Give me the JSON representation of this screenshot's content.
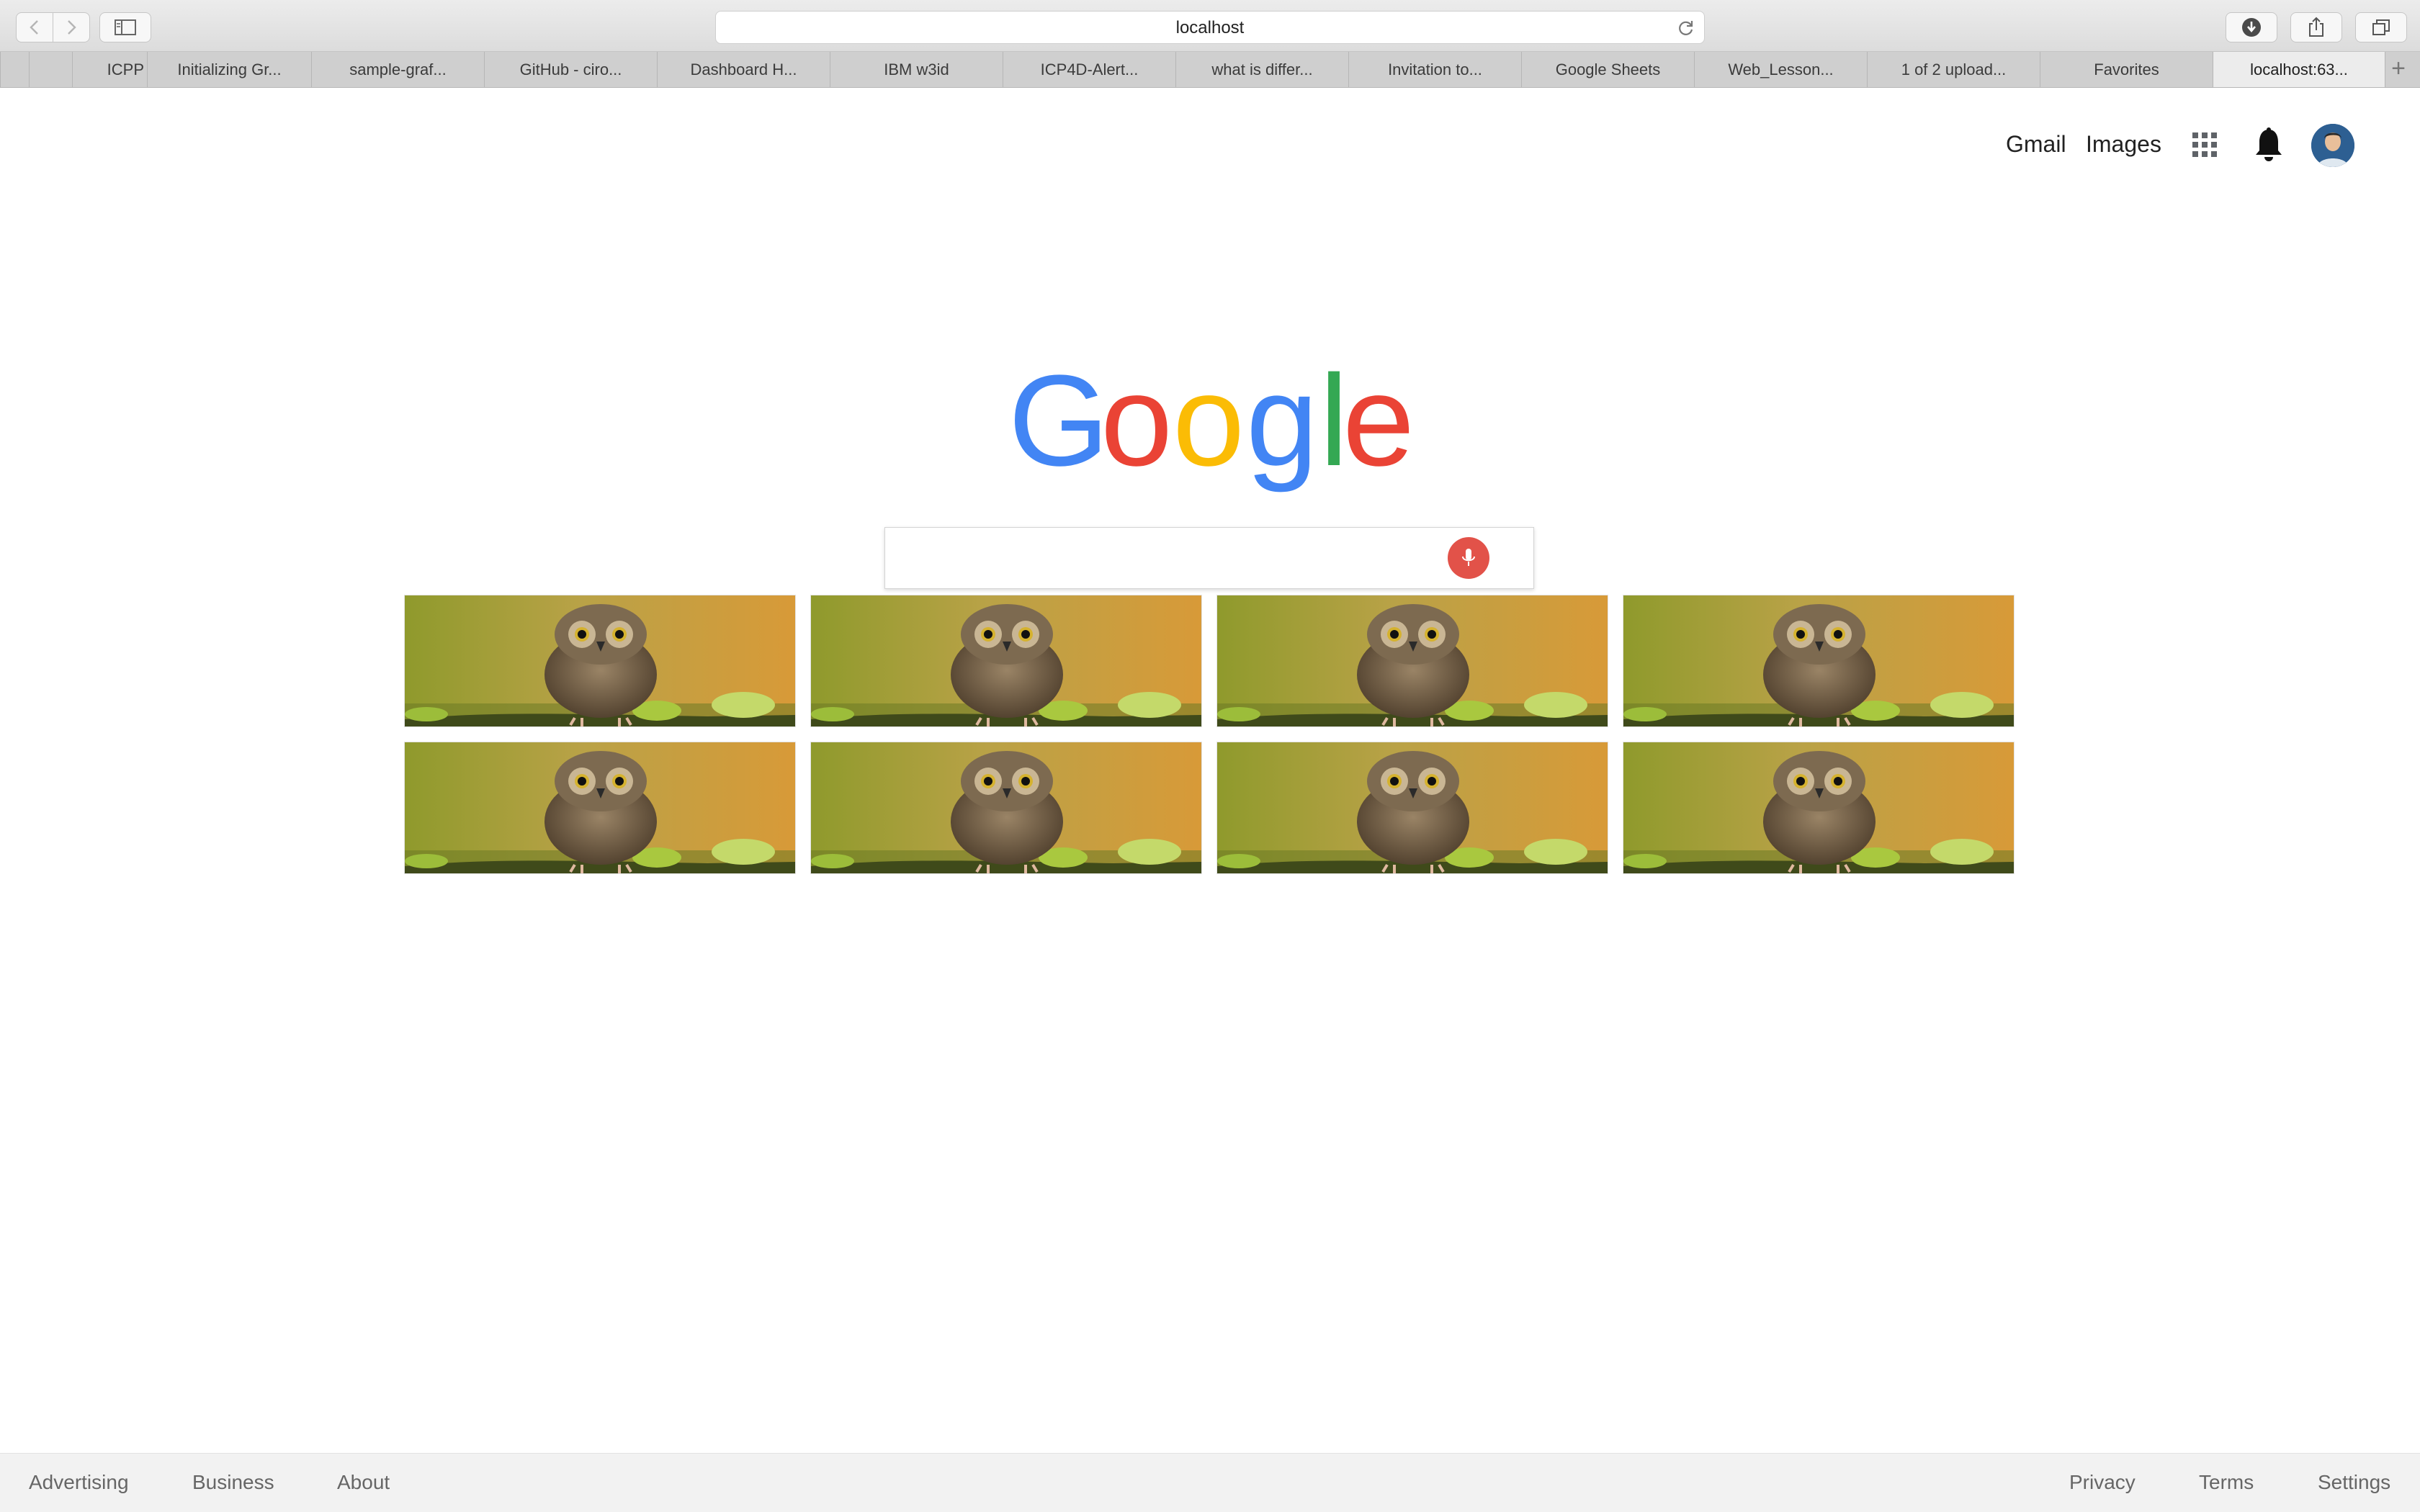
{
  "browser": {
    "address": "localhost",
    "tabs": [
      {
        "label": ""
      },
      {
        "label": ""
      },
      {
        "label": "ICPP"
      },
      {
        "label": "Initializing Gr..."
      },
      {
        "label": "sample-graf..."
      },
      {
        "label": "GitHub - ciro..."
      },
      {
        "label": "Dashboard H..."
      },
      {
        "label": "IBM w3id"
      },
      {
        "label": "ICP4D-Alert..."
      },
      {
        "label": "what is differ..."
      },
      {
        "label": "Invitation to..."
      },
      {
        "label": "Google Sheets"
      },
      {
        "label": "Web_Lesson..."
      },
      {
        "label": "1 of 2 upload..."
      },
      {
        "label": "Favorites"
      },
      {
        "label": "localhost:63...",
        "active": true
      }
    ],
    "new_tab": "+"
  },
  "header": {
    "gmail": "Gmail",
    "images": "Images",
    "icons": [
      "apps-grid-icon",
      "notification-bell-icon",
      "avatar"
    ]
  },
  "logo": {
    "letters": [
      {
        "char": "G",
        "color": "#4285F4"
      },
      {
        "char": "o",
        "color": "#EA4335"
      },
      {
        "char": "o",
        "color": "#FBBC05"
      },
      {
        "char": "g",
        "color": "#4285F4"
      },
      {
        "char": "l",
        "color": "#34A853"
      },
      {
        "char": "e",
        "color": "#EA4335"
      }
    ]
  },
  "search": {
    "value": "",
    "placeholder": "",
    "mic_icon": "microphone-icon",
    "mic_color": "#E25249"
  },
  "gallery": {
    "rows": 2,
    "columns": 4,
    "image": "owl-photo",
    "count": 8
  },
  "footer": {
    "left": [
      "Advertising",
      "Business",
      "About"
    ],
    "right": [
      "Privacy",
      "Terms",
      "Settings"
    ]
  }
}
